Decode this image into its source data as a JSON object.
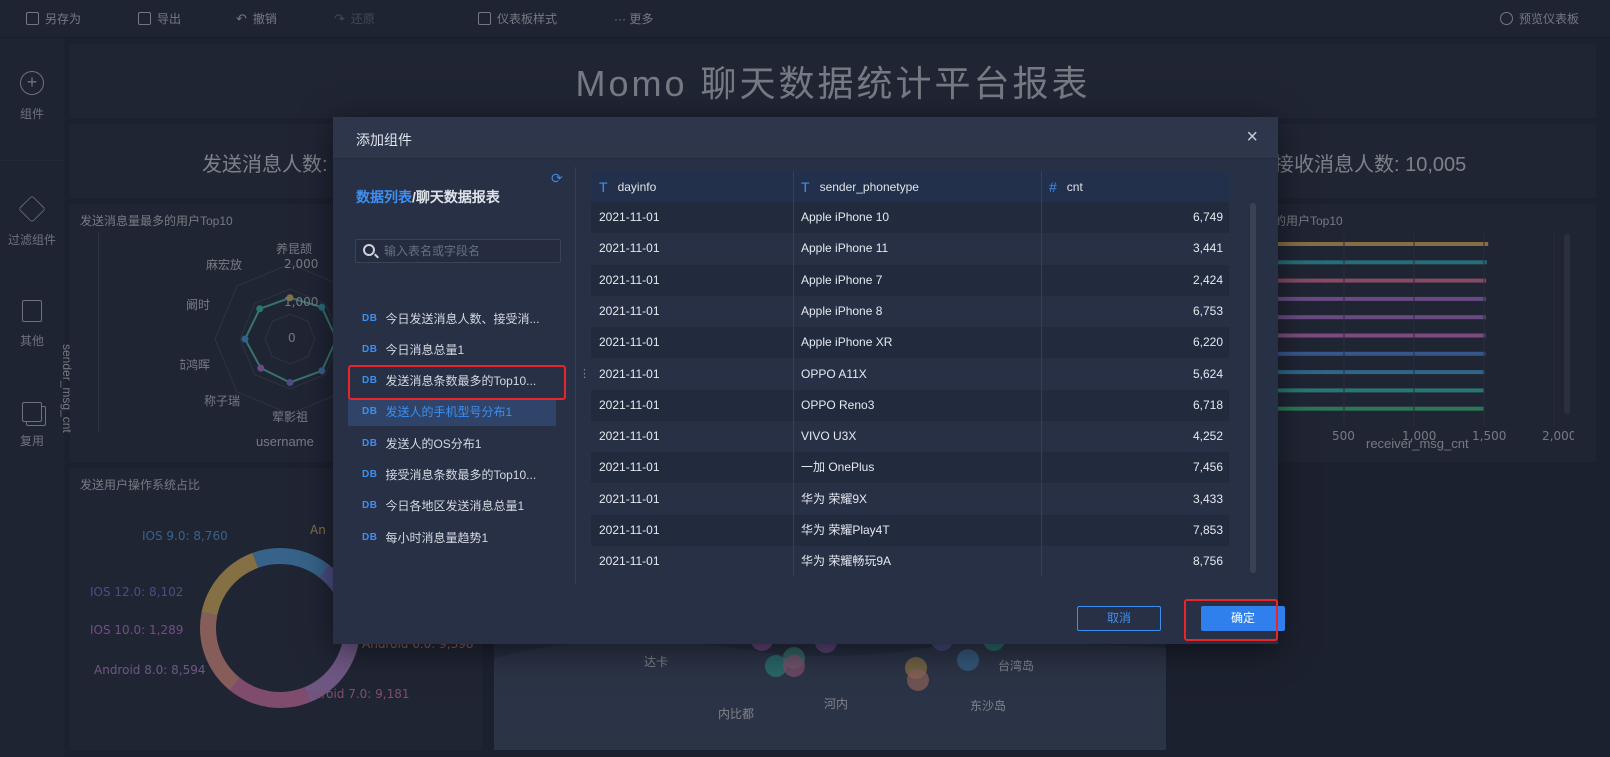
{
  "toolbar": {
    "save_as": "另存为",
    "export": "导出",
    "undo": "撤销",
    "redo": "还原",
    "dashboard_style": "仪表板样式",
    "more": "··· 更多",
    "preview": "预览仪表板"
  },
  "rail": {
    "items": [
      {
        "label": "组件",
        "icon": "plus-circle-icon"
      },
      {
        "label": "过滤组件",
        "icon": "cube-icon"
      },
      {
        "label": "其他",
        "icon": "document-icon"
      },
      {
        "label": "复用",
        "icon": "layers-icon"
      }
    ]
  },
  "dashboard": {
    "title": "Momo 聊天数据统计平台报表",
    "kpi_left_label": "发送消息人数:",
    "kpi_right_label": "接收消息人数: 10,005",
    "radar_card": {
      "title": "发送消息量最多的用户Top10",
      "ylabel": "sender_msg_cnt",
      "xlabel": "username",
      "names": [
        "养昆颉",
        "麻宏放",
        "阚时",
        "茹鸿晖",
        "称子瑞",
        "荤影祖"
      ],
      "ticks": [
        "2,000",
        "1,000",
        "0"
      ]
    },
    "bar_card": {
      "title": "的用户Top10",
      "xlabel": "receiver_msg_cnt",
      "ticks": [
        "500",
        "1,000",
        "1,500",
        "2,000"
      ],
      "values": [
        1530,
        1520,
        1515,
        1513,
        1512,
        1511,
        1510,
        1505,
        1500,
        1498
      ],
      "colors": [
        "#e3b566",
        "#3fb6c2",
        "#e07a9a",
        "#b07ad8",
        "#b07ad8",
        "#d47ad0",
        "#5b8fe3",
        "#4fa6df",
        "#43c6b8",
        "#47c48a"
      ]
    },
    "pie_card": {
      "title": "发送用户操作系统占比",
      "labels": [
        "IOS 9.0: 8,760",
        "IOS 12.0: 8,102",
        "IOS 10.0: 1,289",
        "Android 8.0: 8,594",
        "Android 7.0: 9,181",
        "Android 6.0: 9,398",
        "An"
      ],
      "values": [
        8760,
        8102,
        1289,
        8594,
        9181,
        9398,
        8800
      ],
      "colors": [
        "#5aa3e0",
        "#7d7fd6",
        "#c77ad9",
        "#b88fd6",
        "#d77db0",
        "#e39a8e",
        "#e1b96b"
      ]
    },
    "map_card": {
      "labels": [
        "达卡",
        "河内",
        "内比都",
        "台湾岛",
        "钓鱼岛",
        "东沙岛"
      ]
    }
  },
  "modal": {
    "title": "添加组件",
    "close": "×",
    "breadcrumb_root": "数据列表",
    "breadcrumb_sep": "/",
    "breadcrumb_current": "聊天数据报表",
    "search_placeholder": "输入表名或字段名",
    "datasets": [
      {
        "tag": "DB",
        "name": "今日发送消息人数、接受消..."
      },
      {
        "tag": "DB",
        "name": "今日消息总量1"
      },
      {
        "tag": "DB",
        "name": "发送消息条数最多的Top10..."
      },
      {
        "tag": "DB",
        "name": "发送人的手机型号分布1"
      },
      {
        "tag": "DB",
        "name": "发送人的OS分布1"
      },
      {
        "tag": "DB",
        "name": "接受消息条数最多的Top10..."
      },
      {
        "tag": "DB",
        "name": "今日各地区发送消息总量1"
      },
      {
        "tag": "DB",
        "name": "每小时消息量趋势1"
      }
    ],
    "active_index": 3,
    "columns": [
      {
        "type": "T",
        "name": "dayinfo"
      },
      {
        "type": "T",
        "name": "sender_phonetype"
      },
      {
        "type": "#",
        "name": "cnt"
      }
    ],
    "rows": [
      [
        "2021-11-01",
        "Apple iPhone 10",
        "6,749"
      ],
      [
        "2021-11-01",
        "Apple iPhone 11",
        "3,441"
      ],
      [
        "2021-11-01",
        "Apple iPhone 7",
        "2,424"
      ],
      [
        "2021-11-01",
        "Apple iPhone 8",
        "6,753"
      ],
      [
        "2021-11-01",
        "Apple iPhone XR",
        "6,220"
      ],
      [
        "2021-11-01",
        "OPPO A11X",
        "5,624"
      ],
      [
        "2021-11-01",
        "OPPO Reno3",
        "6,718"
      ],
      [
        "2021-11-01",
        "VIVO U3X",
        "4,252"
      ],
      [
        "2021-11-01",
        "一加 OnePlus",
        "7,456"
      ],
      [
        "2021-11-01",
        "华为 荣耀9X",
        "3,433"
      ],
      [
        "2021-11-01",
        "华为 荣耀Play4T",
        "7,853"
      ],
      [
        "2021-11-01",
        "华为 荣耀畅玩9A",
        "8,756"
      ]
    ],
    "cancel": "取消",
    "confirm": "确定"
  }
}
